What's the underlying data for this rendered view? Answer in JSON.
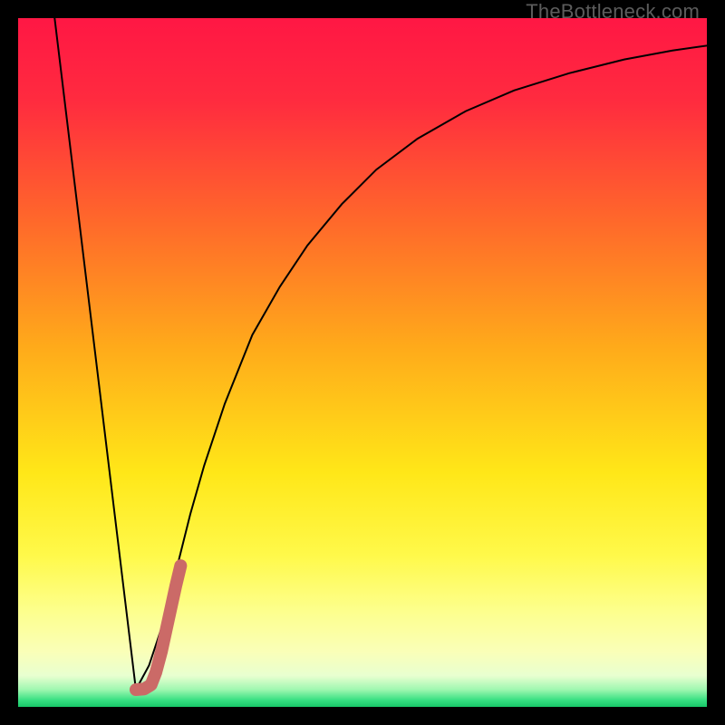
{
  "watermark": "TheBottleneck.com",
  "colors": {
    "frame": "#000000",
    "curve": "#000000",
    "marker": "#cb6a67",
    "gradient_stops": [
      {
        "offset": 0.0,
        "color": "#ff1744"
      },
      {
        "offset": 0.12,
        "color": "#ff2b3f"
      },
      {
        "offset": 0.3,
        "color": "#ff6a2a"
      },
      {
        "offset": 0.48,
        "color": "#ffab1a"
      },
      {
        "offset": 0.66,
        "color": "#ffe718"
      },
      {
        "offset": 0.78,
        "color": "#fff94a"
      },
      {
        "offset": 0.86,
        "color": "#fdff8c"
      },
      {
        "offset": 0.92,
        "color": "#faffb8"
      },
      {
        "offset": 0.955,
        "color": "#e8ffd0"
      },
      {
        "offset": 0.975,
        "color": "#9ff7b0"
      },
      {
        "offset": 0.99,
        "color": "#38e082"
      },
      {
        "offset": 1.0,
        "color": "#18c768"
      }
    ]
  },
  "chart_data": {
    "type": "line",
    "title": "",
    "xlabel": "",
    "ylabel": "",
    "xlim": [
      0,
      100
    ],
    "ylim": [
      0,
      100
    ],
    "series": [
      {
        "name": "left-line",
        "x": [
          5.3,
          17.1
        ],
        "values": [
          100,
          2.5
        ]
      },
      {
        "name": "right-curve",
        "x": [
          17.1,
          19,
          21,
          23,
          25,
          27,
          30,
          34,
          38,
          42,
          47,
          52,
          58,
          65,
          72,
          80,
          88,
          95,
          100
        ],
        "values": [
          2.5,
          6,
          12,
          20,
          28,
          35,
          44,
          54,
          61,
          67,
          73,
          78,
          82.5,
          86.5,
          89.5,
          92,
          94,
          95.3,
          96
        ]
      }
    ],
    "marker": {
      "name": "bottleneck-marker",
      "points_x": [
        17.1,
        18.3,
        19.3,
        20.0,
        20.8,
        21.5,
        22.2,
        22.9,
        23.6
      ],
      "points_y": [
        2.5,
        2.6,
        3.2,
        5.0,
        8.0,
        11.2,
        14.4,
        17.6,
        20.5
      ]
    }
  }
}
